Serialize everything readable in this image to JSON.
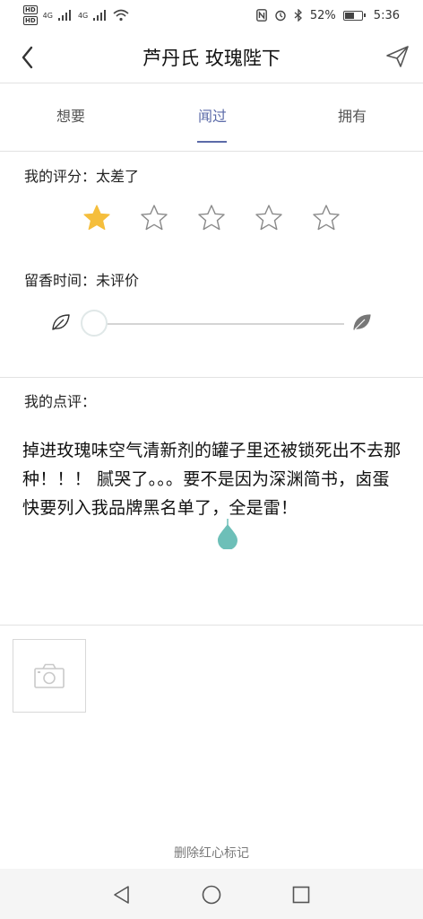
{
  "status_bar": {
    "hd_label": "HD",
    "signal_1": "4G",
    "signal_2": "4G",
    "battery_percent": "52%",
    "battery_level": 0.52,
    "time": "5:36"
  },
  "header": {
    "title": "芦丹氏 玫瑰陛下"
  },
  "tabs": [
    {
      "label": "想要",
      "active": false
    },
    {
      "label": "闻过",
      "active": true
    },
    {
      "label": "拥有",
      "active": false
    }
  ],
  "rating": {
    "label": "我的评分：",
    "value_text": "太差了",
    "stars_total": 5,
    "stars_filled": 1,
    "star_filled_color": "#f5be3c"
  },
  "longevity": {
    "label": "留香时间：",
    "value_text": "未评价"
  },
  "review": {
    "label": "我的点评：",
    "text": "掉进玫瑰味空气清新剂的罐子里还被锁死出不去那种！！！ 腻哭了。。。要不是因为深渊简书，卤蛋快要列入我品牌黑名单了，全是雷！"
  },
  "photo": {
    "icon": "camera-icon"
  },
  "footer": {
    "delete_label": "删除红心标记"
  },
  "colors": {
    "accent": "#5b6aa8",
    "cursor": "#6dbfb8"
  }
}
